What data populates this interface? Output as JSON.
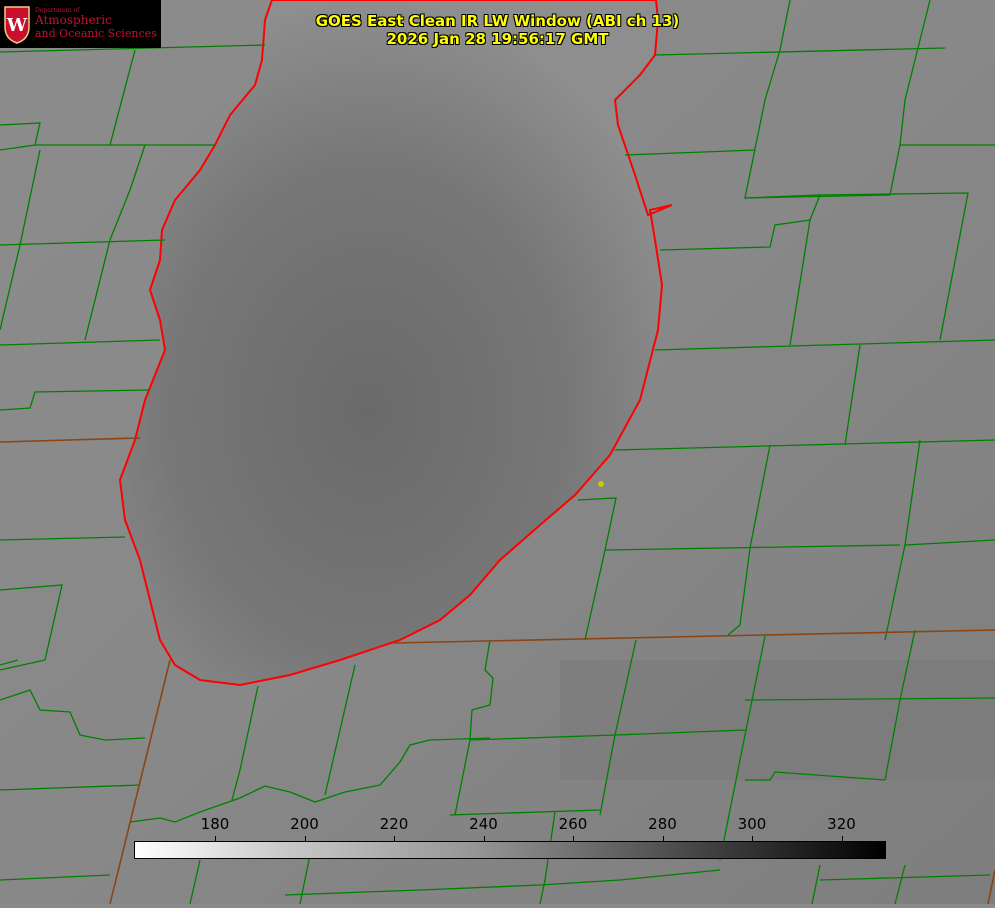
{
  "header": {
    "title_line1": "GOES East Clean IR LW Window (ABI ch 13)",
    "title_line2": "2026 Jan 28 19:56:17 GMT"
  },
  "logo": {
    "dept": "Department of",
    "line1": "Atmospheric",
    "line2": "and Oceanic Sciences",
    "seal_letter": "W"
  },
  "colorbar": {
    "ticks": [
      "180",
      "200",
      "220",
      "240",
      "260",
      "280",
      "300",
      "320"
    ]
  },
  "colors": {
    "title": "#ffff00",
    "lake_outline": "#ff0000",
    "county_lines": "#008000",
    "state_lines": "#8b4513",
    "marker": "#d4c400"
  }
}
